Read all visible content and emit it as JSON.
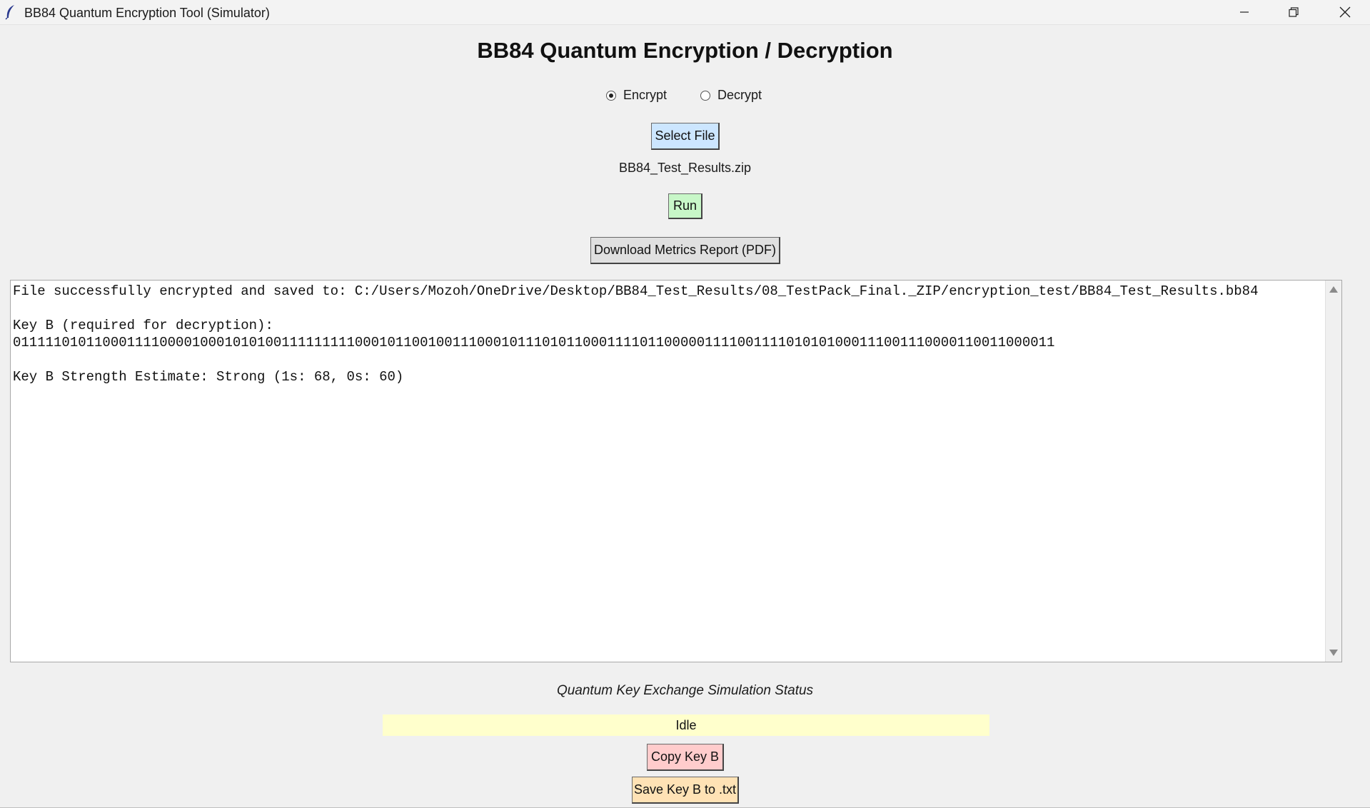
{
  "window": {
    "title": "BB84 Quantum Encryption Tool (Simulator)",
    "app_icon": "feather-icon",
    "controls": [
      "minimize-icon",
      "restore-icon",
      "close-icon"
    ]
  },
  "main": {
    "heading": "BB84 Quantum Encryption / Decryption",
    "mode": {
      "options": [
        {
          "label": "Encrypt",
          "selected": true
        },
        {
          "label": "Decrypt",
          "selected": false
        }
      ]
    },
    "select_file_label": "Select File",
    "selected_file": "BB84_Test_Results.zip",
    "run_label": "Run",
    "download_label": "Download Metrics Report (PDF)",
    "output_lines": [
      "File successfully encrypted and saved to: C:/Users/Mozoh/OneDrive/Desktop/BB84_Test_Results/08_TestPack_Final._ZIP/encryption_test/BB84_Test_Results.bb84",
      "",
      "Key B (required for decryption):",
      "01111101011000111100001000101010011111111100010110010011100010111010110001111011000001111001111010101000111001110000110011000011",
      "",
      "Key B Strength Estimate: Strong (1s: 68, 0s: 60)"
    ],
    "status_label": "Quantum Key Exchange Simulation Status",
    "status_value": "Idle",
    "copy_key_label": "Copy Key B",
    "save_key_label": "Save Key B to .txt"
  },
  "colors": {
    "select_file_bg": "#cce6ff",
    "run_bg": "#c8f7c8",
    "download_bg": "#e0e0e0",
    "copy_bg": "#ffcccc",
    "save_bg": "#ffe2b5",
    "status_bg": "#ffffcc"
  }
}
